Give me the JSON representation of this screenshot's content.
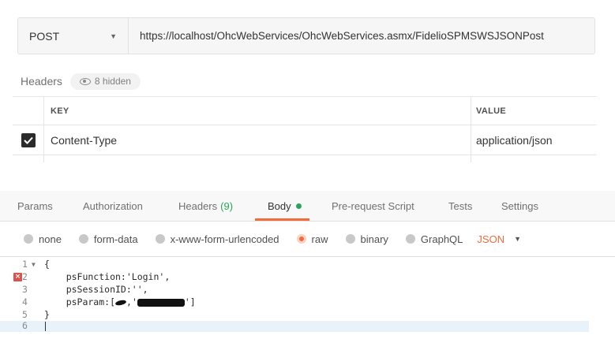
{
  "request": {
    "method": "POST",
    "url": "https://localhost/OhcWebServices/OhcWebServices.asmx/FidelioSPMSWSJSONPost"
  },
  "headers_section": {
    "title": "Headers",
    "hidden_label": "8 hidden",
    "columns": {
      "key": "KEY",
      "value": "VALUE"
    },
    "rows": [
      {
        "key": "Content-Type",
        "value": "application/json",
        "checked": true
      }
    ]
  },
  "tabs": [
    {
      "label": "Params"
    },
    {
      "label": "Authorization"
    },
    {
      "label": "Headers",
      "count": "(9)"
    },
    {
      "label": "Body",
      "active": true
    },
    {
      "label": "Pre-request Script"
    },
    {
      "label": "Tests"
    },
    {
      "label": "Settings"
    }
  ],
  "body_types": {
    "options": [
      "none",
      "form-data",
      "x-www-form-urlencoded",
      "raw",
      "binary",
      "GraphQL"
    ],
    "selected": "raw",
    "format": "JSON"
  },
  "editor": {
    "lines": [
      {
        "num": "1",
        "text": "{"
      },
      {
        "num": "2",
        "text": "    psFunction:'Login',"
      },
      {
        "num": "3",
        "text": "    psSessionID:'',"
      },
      {
        "num": "4",
        "prefix": "    psParam:[",
        "suffix": "']"
      },
      {
        "num": "5",
        "text": "}"
      },
      {
        "num": "6",
        "text": ""
      }
    ]
  },
  "colors": {
    "accent": "#f26b3a",
    "success": "#26a65b",
    "error": "#d9534f"
  }
}
